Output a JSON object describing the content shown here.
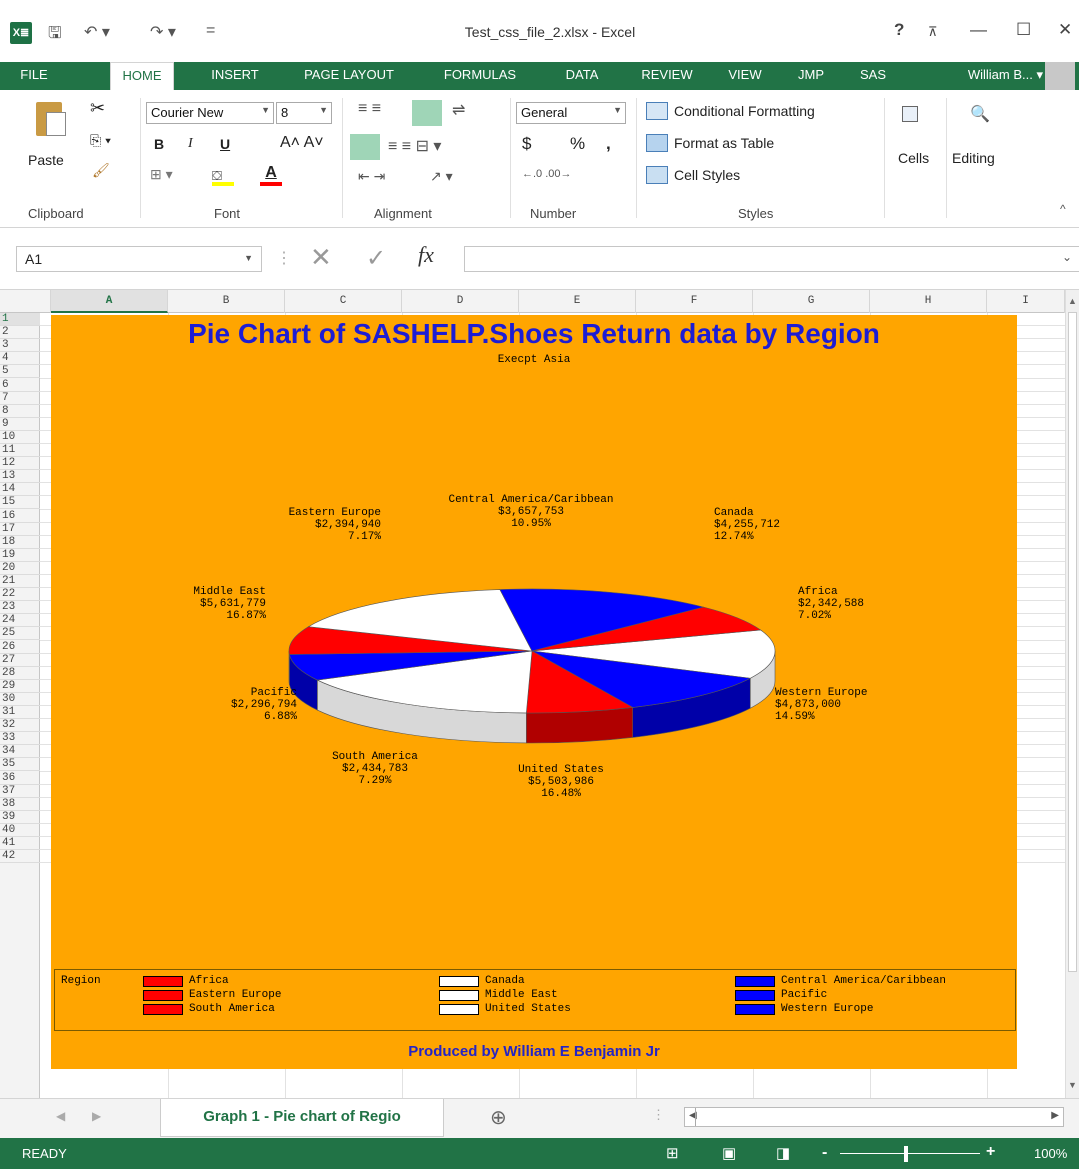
{
  "window": {
    "title": "Test_css_file_2.xlsx - Excel",
    "help": "?",
    "restore_ribbon": "⊼",
    "minimize": "—",
    "maximize": "☐",
    "close": "✕"
  },
  "qat": {
    "save": "🖫",
    "undo": "↶ ▾",
    "redo": "↷ ▾",
    "customize": "="
  },
  "tabs": [
    "FILE",
    "HOME",
    "INSERT",
    "PAGE LAYOUT",
    "FORMULAS",
    "DATA",
    "REVIEW",
    "VIEW",
    "JMP",
    "SAS"
  ],
  "user": "William B... ▾",
  "ribbon": {
    "clipboard": {
      "label": "Clipboard",
      "paste": "Paste"
    },
    "font": {
      "label": "Font",
      "name": "Courier New",
      "size": "8",
      "bold": "B",
      "italic": "I",
      "underline": "U"
    },
    "alignment": {
      "label": "Alignment"
    },
    "number": {
      "label": "Number",
      "format": "General",
      "currency": "$",
      "percent": "%",
      "comma": ","
    },
    "styles": {
      "label": "Styles",
      "conditional": "Conditional Formatting",
      "format_table": "Format as Table",
      "cell_styles": "Cell Styles"
    },
    "cells": {
      "label": "Cells"
    },
    "editing": {
      "label": "Editing"
    }
  },
  "formula_bar": {
    "name_box": "A1",
    "fx": "fx",
    "value": ""
  },
  "columns": [
    "A",
    "B",
    "C",
    "D",
    "E",
    "F",
    "G",
    "H",
    "I"
  ],
  "rows": [
    "1",
    "2",
    "3",
    "4",
    "5",
    "6",
    "7",
    "8",
    "9",
    "10",
    "11",
    "12",
    "13",
    "14",
    "15",
    "16",
    "17",
    "18",
    "19",
    "20",
    "21",
    "22",
    "23",
    "24",
    "25",
    "26",
    "27",
    "28",
    "29",
    "30",
    "31",
    "32",
    "33",
    "34",
    "35",
    "36",
    "37",
    "38",
    "39",
    "40",
    "41",
    "42"
  ],
  "chart_data": {
    "type": "pie",
    "title": "Pie Chart of SASHELP.Shoes Return data by Region",
    "subtitle": "Execpt Asia",
    "footnote": "Produced by William E Benjamin Jr",
    "legend_title": "Region",
    "legend_position": "bottom",
    "slices": [
      {
        "name": "Africa",
        "value": 2342588,
        "value_label": "$2,342,588",
        "percent_label": "7.02%",
        "color": "#ff0000"
      },
      {
        "name": "Canada",
        "value": 4255712,
        "value_label": "$4,255,712",
        "percent_label": "12.74%",
        "color": "#ffffff"
      },
      {
        "name": "Central America/Caribbean",
        "value": 3657753,
        "value_label": "$3,657,753",
        "percent_label": "10.95%",
        "color": "#0000ff"
      },
      {
        "name": "Eastern Europe",
        "value": 2394940,
        "value_label": "$2,394,940",
        "percent_label": "7.17%",
        "color": "#ff0000"
      },
      {
        "name": "Middle East",
        "value": 5631779,
        "value_label": "$5,631,779",
        "percent_label": "16.87%",
        "color": "#ffffff"
      },
      {
        "name": "Pacific",
        "value": 2296794,
        "value_label": "$2,296,794",
        "percent_label": "6.88%",
        "color": "#0000ff"
      },
      {
        "name": "South America",
        "value": 2434783,
        "value_label": "$2,434,783",
        "percent_label": "7.29%",
        "color": "#ff0000"
      },
      {
        "name": "United States",
        "value": 5503986,
        "value_label": "$5,503,986",
        "percent_label": "16.48%",
        "color": "#ffffff"
      },
      {
        "name": "Western Europe",
        "value": 4873000,
        "value_label": "$4,873,000",
        "percent_label": "14.59%",
        "color": "#0000ff"
      }
    ],
    "background_color": "#ffa500",
    "title_color": "#1d1dd4"
  },
  "sheet_tab": "Graph 1 - Pie chart of Regio",
  "status": {
    "ready": "READY",
    "zoom": "100%",
    "minus": "-",
    "plus": "+"
  }
}
